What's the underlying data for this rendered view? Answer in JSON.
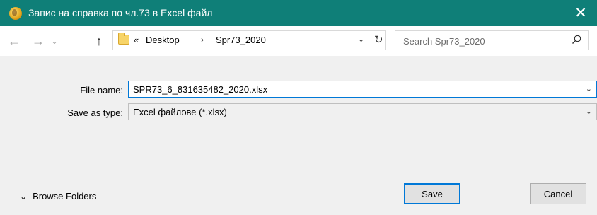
{
  "window": {
    "title": "Запис на справка по чл.73 в Excel файл",
    "close_glyph": "✕"
  },
  "nav": {
    "back_glyph": "←",
    "forward_glyph": "→",
    "recent_glyph": "⌄",
    "up_glyph": "↑",
    "overflow": "«",
    "breadcrumbs": [
      "Desktop",
      "Spr73_2020"
    ],
    "breadcrumb_sep": "›",
    "dropdown_glyph": "⌄",
    "refresh_glyph": "↻",
    "search_placeholder": "Search Spr73_2020"
  },
  "form": {
    "file_name_label": "File name:",
    "file_name_value": "SPR73_6_831635482_2020.xlsx",
    "save_type_label": "Save as type:",
    "save_type_value": "Excel файлове (*.xlsx)",
    "caret": "⌄"
  },
  "footer": {
    "browse_label": "Browse Folders",
    "browse_glyph": "⌄",
    "save_label": "Save",
    "cancel_label": "Cancel"
  },
  "colors": {
    "titlebar": "#0f7f78",
    "focus": "#0078d7"
  }
}
